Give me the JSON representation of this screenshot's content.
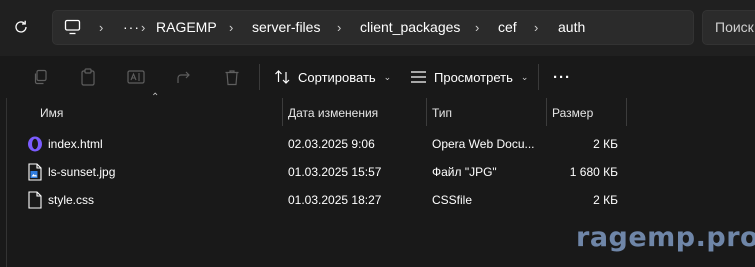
{
  "address_bar": {
    "breadcrumb": [
      "RAGEMP",
      "server-files",
      "client_packages",
      "cef",
      "auth"
    ],
    "overflow_label": "···",
    "search_placeholder": "Поиск"
  },
  "toolbar": {
    "sort_label": "Сортировать",
    "view_label": "Просмотреть",
    "more_label": "···"
  },
  "columns": {
    "name": "Имя",
    "date": "Дата изменения",
    "type": "Тип",
    "size": "Размер"
  },
  "files": [
    {
      "name": "index.html",
      "date": "02.03.2025 9:06",
      "type": "Opera Web Docu...",
      "size": "2 КБ",
      "icon": "opera-icon"
    },
    {
      "name": "ls-sunset.jpg",
      "date": "01.03.2025 15:57",
      "type": "Файл \"JPG\"",
      "size": "1 680 КБ",
      "icon": "image-file-icon"
    },
    {
      "name": "style.css",
      "date": "01.03.2025 18:27",
      "type": "CSSfile",
      "size": "2 КБ",
      "icon": "file-icon"
    }
  ],
  "watermark": "ragemp.pro"
}
